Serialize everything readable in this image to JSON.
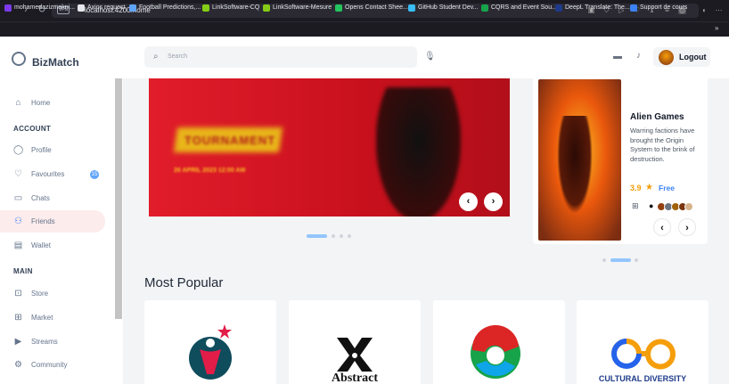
{
  "browser": {
    "url": "localhost:4200/home",
    "vpn_label": "VPN",
    "bookmarks": [
      {
        "label": "mohamedazizmakni...",
        "color": "#7c3aed"
      },
      {
        "label": "Axios request",
        "color": "#e5e7eb"
      },
      {
        "label": "Football Predictions,...",
        "color": "#60a5fa"
      },
      {
        "label": "LinkSoftware-CQ",
        "color": "#84cc16"
      },
      {
        "label": "LinkSoftware-Mesure",
        "color": "#84cc16"
      },
      {
        "label": "Opens Contact Shee...",
        "color": "#22c55e"
      },
      {
        "label": "GitHub Student Dev...",
        "color": "#38bdf8"
      },
      {
        "label": "CQRS and Event Sou...",
        "color": "#16a34a"
      },
      {
        "label": "DeepL Translate: The...",
        "color": "#1e3a8a"
      },
      {
        "label": "Support de cours",
        "color": "#3b82f6"
      }
    ]
  },
  "app": {
    "brand": "BizMatch",
    "nav": {
      "home": "Home",
      "account_section": "ACCOUNT",
      "profile": "Profile",
      "favourites": "Favourites",
      "favourites_badge": "15",
      "chats": "Chats",
      "friends": "Friends",
      "wallet": "Wallet",
      "main_section": "MAIN",
      "store": "Store",
      "market": "Market",
      "streams": "Streams",
      "community": "Community"
    }
  },
  "header": {
    "search_placeholder": "Search",
    "logout": "Logout"
  },
  "banner": {
    "headline": "TOURNAMENT",
    "subline": "26 APRIL 2023   12:00 AM",
    "prev": "‹",
    "next": "›",
    "active_slide": 0,
    "slides": 4
  },
  "game": {
    "title": "Alien Games",
    "description": "Warring factions have brought the Origin System to the brink of destruction.",
    "rating": "3.9",
    "price": "Free",
    "active_slide": 1,
    "slides": 3
  },
  "popular": {
    "title": "Most Popular",
    "cards": [
      {
        "name": "logo-1",
        "caption": ""
      },
      {
        "name": "abstract-logo",
        "caption": "Abstract"
      },
      {
        "name": "sphere-logo",
        "caption": ""
      },
      {
        "name": "cultural-diversity-logo",
        "caption": "CULTURAL DIVERSITY"
      }
    ]
  },
  "colors": {
    "accent": "#3b82f6",
    "banner_red": "#e11d2a",
    "star": "#f59e0b"
  }
}
